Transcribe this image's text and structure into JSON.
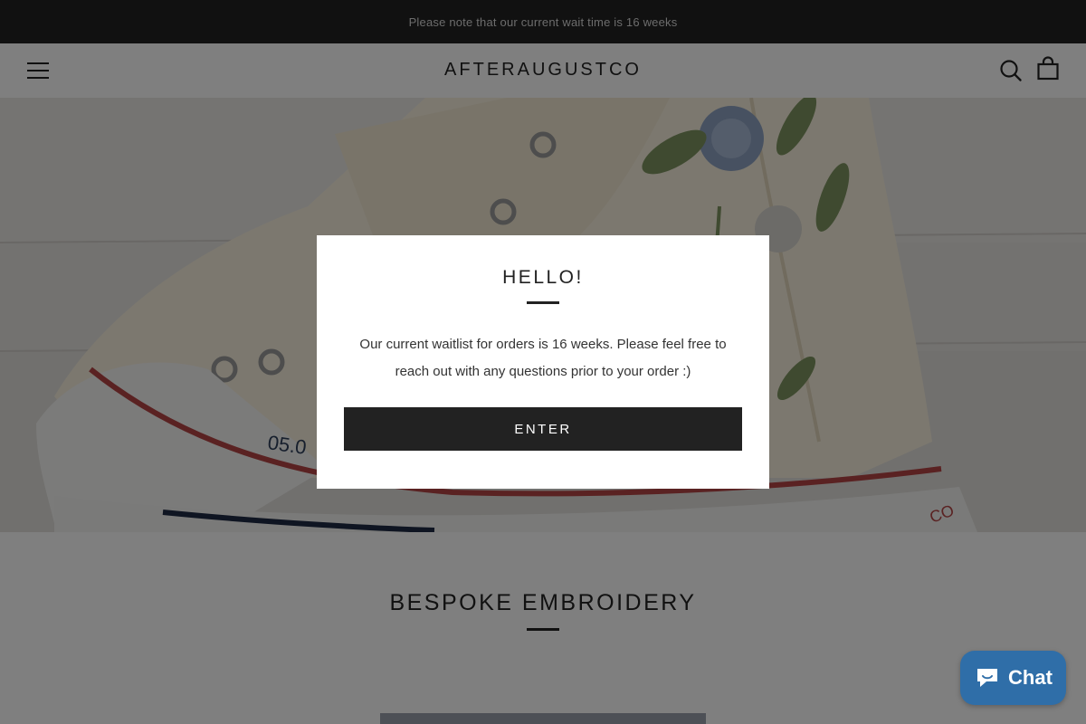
{
  "announcement": {
    "text": "Please note that our current wait time is 16 weeks"
  },
  "header": {
    "logo": "AFTERAUGUSTCO",
    "menu_icon": "hamburger-menu-icon",
    "search_icon": "search-icon",
    "cart_icon": "shopping-bag-icon"
  },
  "hero": {
    "image": "embroidered-high-top-sneaker-photo"
  },
  "section": {
    "title": "BESPOKE EMBROIDERY"
  },
  "modal": {
    "title": "HELLO!",
    "text": "Our current waitlist for orders is 16 weeks. Please feel free to reach out with any questions prior to your order :)",
    "button_label": "ENTER"
  },
  "chat": {
    "label": "Chat",
    "icon": "chat-bubble-icon"
  },
  "colors": {
    "bar": "#222222",
    "accent": "#2f6ea8",
    "overlay": "rgba(0,0,0,0.5)"
  }
}
